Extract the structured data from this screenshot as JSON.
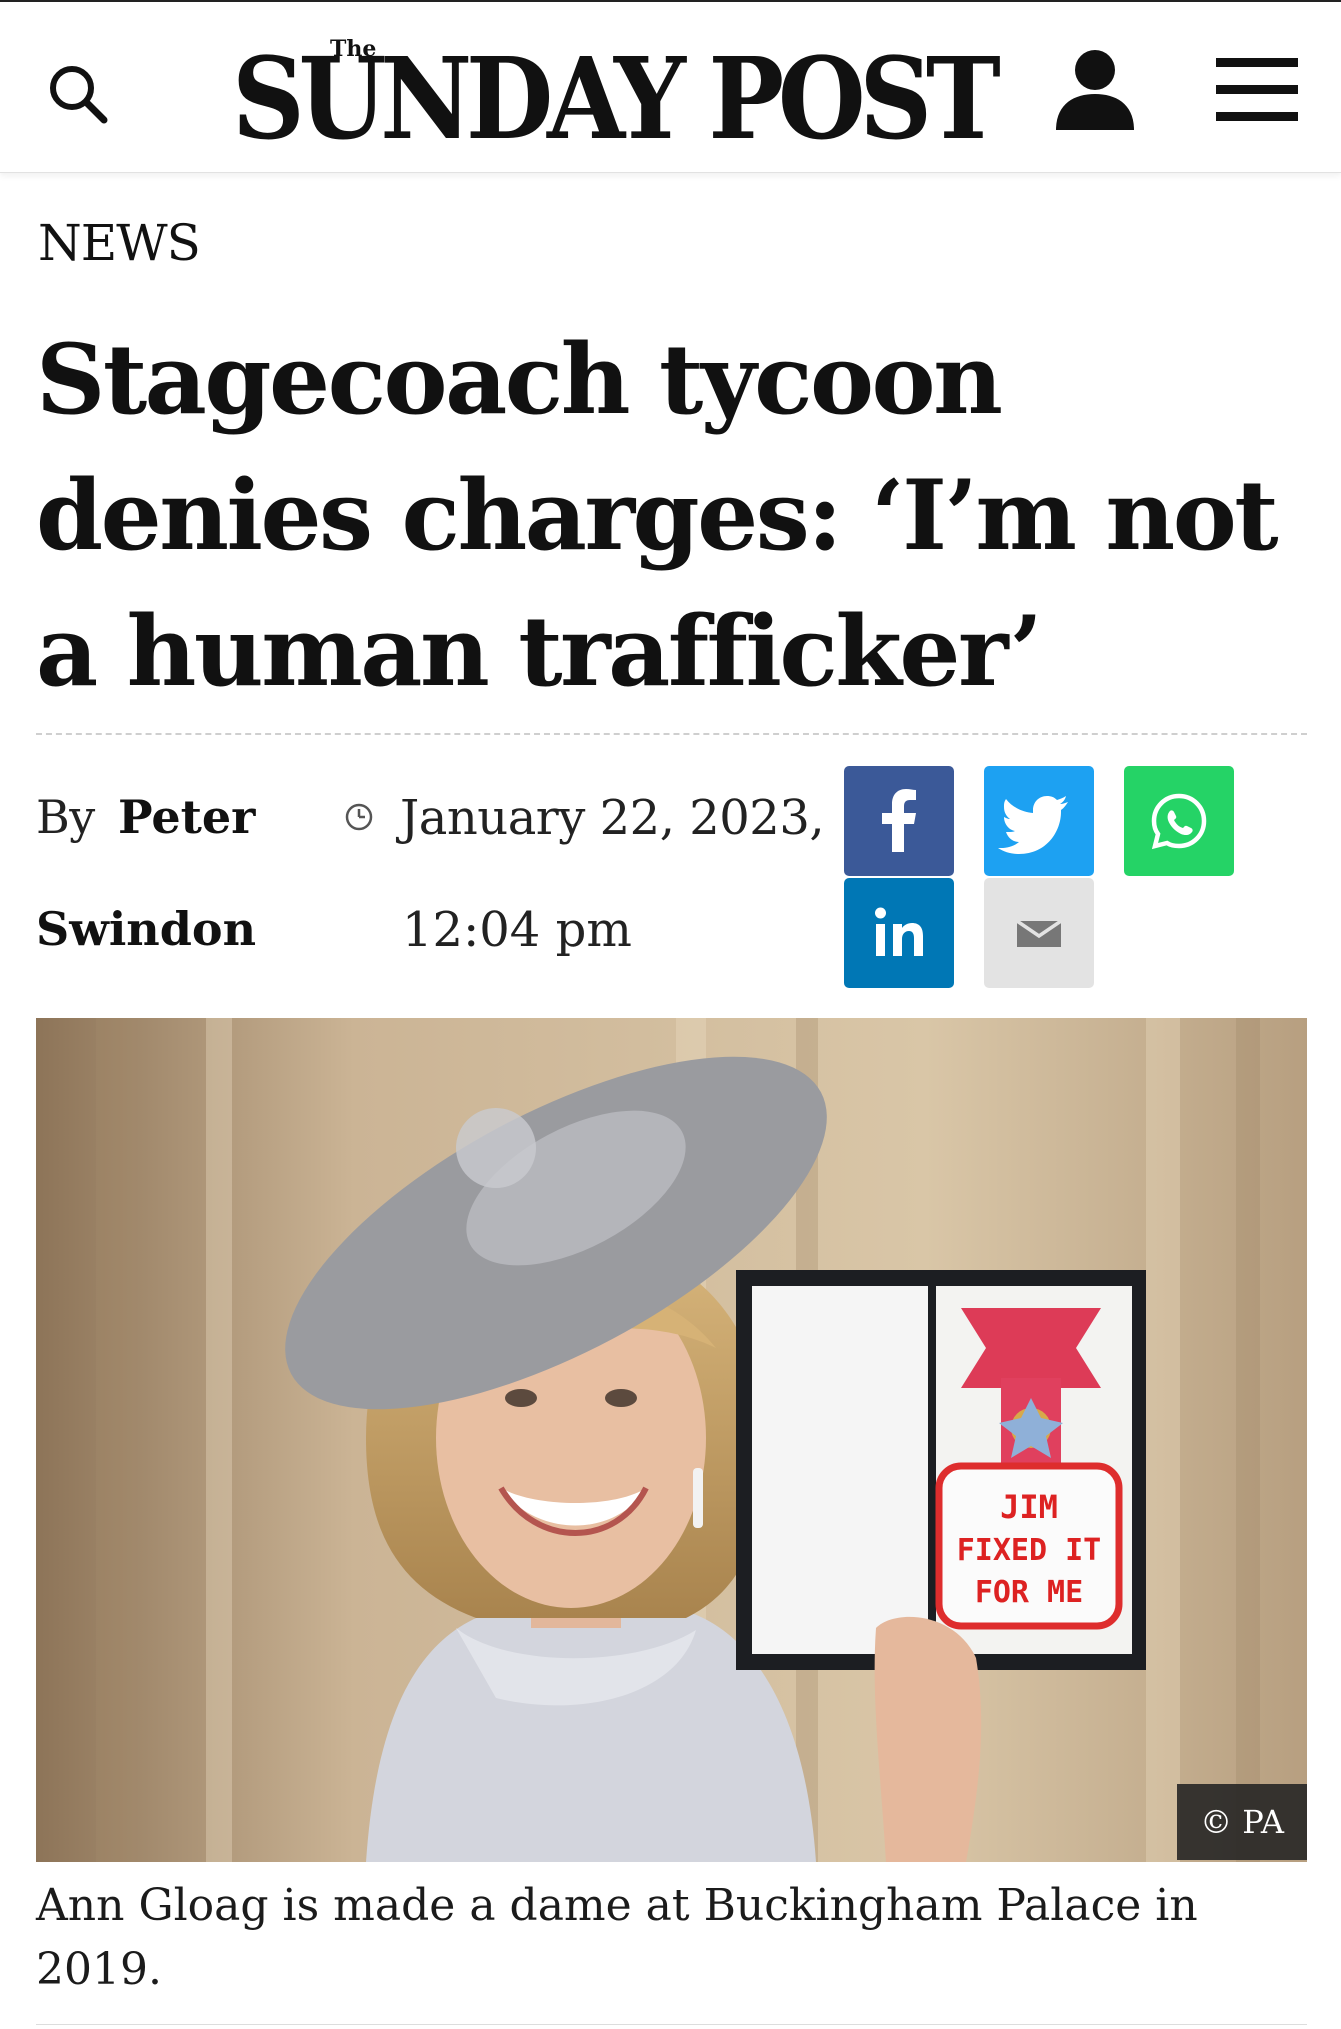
{
  "header": {
    "logo_small": "The",
    "logo_main": "SUNDAY POST",
    "search_icon": "search-icon",
    "user_icon": "user-icon",
    "menu_icon": "hamburger-menu-icon"
  },
  "article": {
    "category": "NEWS",
    "headline": "Stagecoach tycoon denies charges: ‘I’m not a human trafficker’",
    "byline_prefix": "By",
    "author_first": "Peter",
    "author_last": "Swindon",
    "date": "January 22, 2023,",
    "time": "12:04 pm"
  },
  "share": {
    "facebook_icon": "facebook-icon",
    "twitter_icon": "twitter-icon",
    "whatsapp_icon": "whatsapp-icon",
    "linkedin_icon": "linkedin-icon",
    "email_icon": "email-icon",
    "colors": {
      "facebook": "#3b5998",
      "twitter": "#1da1f2",
      "whatsapp": "#25d366",
      "linkedin": "#0077b5",
      "email": "#e3e3e3"
    }
  },
  "photo": {
    "badge_line1": "JIM",
    "badge_line2": "FIXED IT",
    "badge_line3": "FOR ME",
    "credit": "© PA",
    "caption": "Ann Gloag is made a dame at Buckingham Palace in 2019."
  }
}
